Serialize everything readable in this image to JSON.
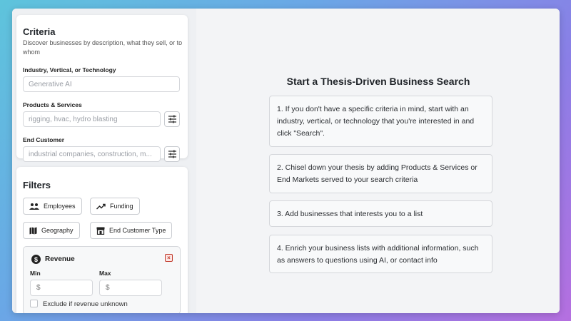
{
  "criteria": {
    "title": "Criteria",
    "subtitle": "Discover businesses by description, what they sell, or to whom",
    "industry": {
      "label": "Industry, Vertical, or Technology",
      "placeholder": "Generative AI"
    },
    "products": {
      "label": "Products & Services",
      "placeholder": "rigging, hvac, hydro blasting"
    },
    "customer": {
      "label": "End Customer",
      "placeholder": "industrial companies, construction, m..."
    }
  },
  "filters": {
    "title": "Filters",
    "chips": [
      {
        "label": "Employees",
        "icon": "people-icon"
      },
      {
        "label": "Funding",
        "icon": "trend-up-icon"
      },
      {
        "label": "Geography",
        "icon": "map-icon"
      },
      {
        "label": "End Customer Type",
        "icon": "store-icon"
      }
    ],
    "revenue": {
      "title": "Revenue",
      "min_label": "Min",
      "max_label": "Max",
      "currency": "$",
      "exclude_label": "Exclude if revenue unknown"
    }
  },
  "main": {
    "title": "Start a Thesis-Driven Business Search",
    "steps": [
      "1. If you don't have a specific criteria in mind, start with an industry, vertical, or technology that you're interested in and click \"Search\".",
      "2. Chisel down your thesis by adding Products & Services or End Markets served to your search criteria",
      "3. Add businesses that interests you to a list",
      "4. Enrich your business lists with additional information, such as answers to questions using AI, or contact info"
    ]
  },
  "colors": {
    "accent_close": "#c0392b",
    "gradient": [
      "#5ec4dc",
      "#b56fe0"
    ]
  }
}
